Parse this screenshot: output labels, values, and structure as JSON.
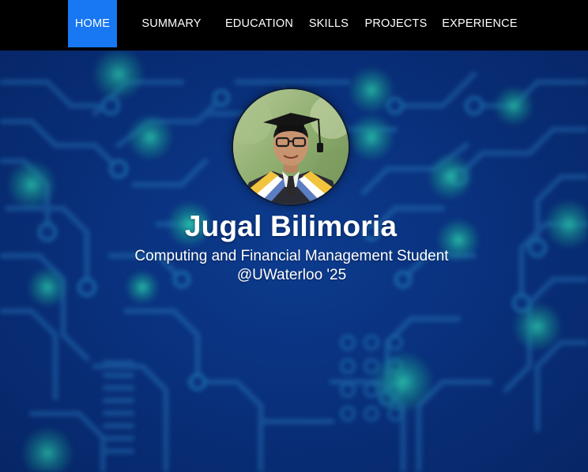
{
  "nav": {
    "items": [
      {
        "label": "HOME",
        "active": true
      },
      {
        "label": "SUMMARY",
        "active": false
      },
      {
        "label": "EDUCATION",
        "active": false
      },
      {
        "label": "SKILLS",
        "active": false
      },
      {
        "label": "PROJECTS",
        "active": false
      },
      {
        "label": "EXPERIENCE",
        "active": false
      }
    ],
    "active_color": "#1877f2",
    "background": "#000000"
  },
  "hero": {
    "name": "Jugal Bilimoria",
    "subtitle_line1": "Computing and Financial Management Student",
    "subtitle_line2": "@UWaterloo '25",
    "background_theme": "circuit-board",
    "background_color": "#0a3483",
    "accent_color": "#17a59a"
  },
  "avatar": {
    "icon": "graduation-portrait"
  }
}
